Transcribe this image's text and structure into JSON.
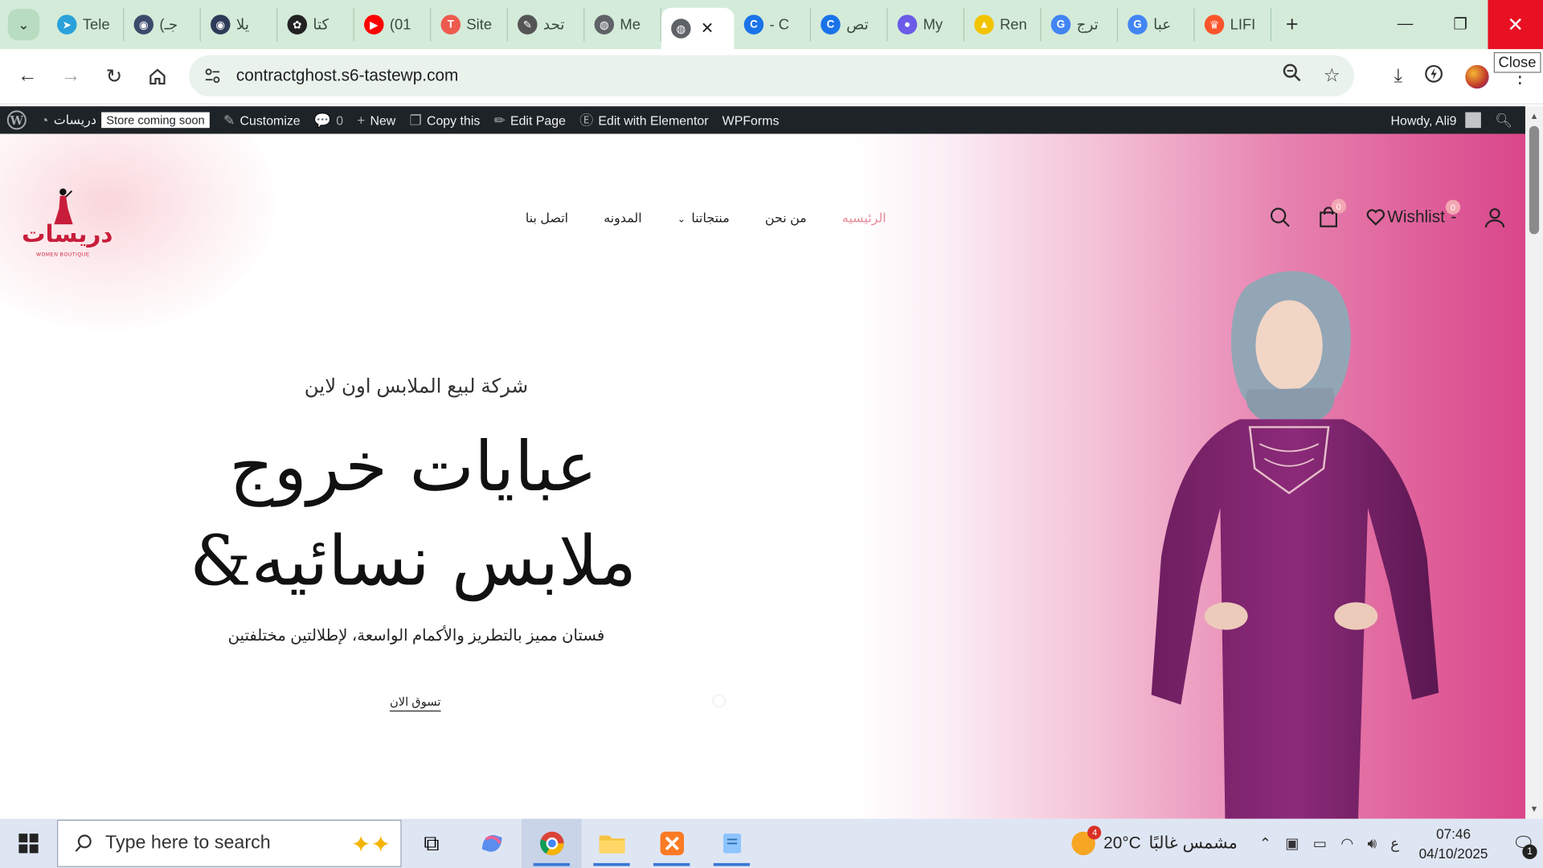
{
  "browser": {
    "tabs": [
      {
        "title": "Tele",
        "icon": "telegram-icon",
        "color": "#2aa1da",
        "glyph": "➤"
      },
      {
        "title": "(جـ",
        "icon": "globe-icon",
        "color": "#3b4a6b",
        "glyph": "◉"
      },
      {
        "title": "يلا",
        "icon": "globe-icon",
        "color": "#2d3b58",
        "glyph": "◉"
      },
      {
        "title": "كتا",
        "icon": "chatgpt-icon",
        "color": "#222222",
        "glyph": "✿"
      },
      {
        "title": "(01",
        "icon": "youtube-icon",
        "color": "#ff0000",
        "glyph": "▶"
      },
      {
        "title": "Site",
        "icon": "tistory-icon",
        "color": "#ef5a4f",
        "glyph": "T"
      },
      {
        "title": "تحد",
        "icon": "quill-icon",
        "color": "#555555",
        "glyph": "✎"
      },
      {
        "title": "Me",
        "icon": "globe-icon",
        "color": "#5f6368",
        "glyph": "◍"
      },
      {
        "title": "",
        "icon": "globe-icon",
        "color": "#5f6368",
        "glyph": "◍",
        "active": true
      },
      {
        "title": "- C",
        "icon": "copilot-icon",
        "color": "#1a73e8",
        "glyph": "C"
      },
      {
        "title": "تص",
        "icon": "copilot-icon",
        "color": "#1a73e8",
        "glyph": "C"
      },
      {
        "title": "My",
        "icon": "my-app-icon",
        "color": "#6b5be8",
        "glyph": "●"
      },
      {
        "title": "Ren",
        "icon": "rendering-icon",
        "color": "#f2c400",
        "glyph": "▲"
      },
      {
        "title": "ترج",
        "icon": "google-icon",
        "color": "#4285f4",
        "glyph": "G"
      },
      {
        "title": "عبا",
        "icon": "google-icon",
        "color": "#4285f4",
        "glyph": "G"
      },
      {
        "title": "LIFI",
        "icon": "brave-icon",
        "color": "#fb542b",
        "glyph": "♛"
      }
    ],
    "close_tooltip": "Close",
    "url": "contractghost.s6-tastewp.com"
  },
  "adminbar": {
    "site_name": "دريسات",
    "store_badge": "Store coming soon",
    "customize": "Customize",
    "comments": "0",
    "new": "New",
    "copy": "Copy this",
    "edit_page": "Edit Page",
    "elementor": "Edit with Elementor",
    "wpforms": "WPForms",
    "howdy": "Howdy, Ali9"
  },
  "site": {
    "logo_text": "دريسات",
    "logo_sub": "WOMEN BOUTIQUE",
    "menu": [
      {
        "label": "الرئيسيه",
        "active": true
      },
      {
        "label": "من نحن"
      },
      {
        "label": "منتجاتنا",
        "dropdown": true
      },
      {
        "label": "المدونه"
      },
      {
        "label": "اتصل بنا"
      }
    ],
    "cart_count": "0",
    "wishlist_label": "Wishlist",
    "wishlist_suffix": "-",
    "wishlist_count": "0",
    "hero": {
      "subtitle": "شركة لبيع الملابس اون لاين",
      "title_line1": "عبايات خروج",
      "title_line2": "&ملابس نسائيه",
      "description": "فستان مميز بالتطريز والأكمام الواسعة، لإطلالتين مختلفتين",
      "cta": "تسوق الان"
    }
  },
  "taskbar": {
    "search_placeholder": "Type here to search",
    "weather_temp": "20°C",
    "weather_text": "مشمس غالبًا",
    "weather_badge": "4",
    "lang": "ع",
    "time": "07:46",
    "date": "04/10/2025",
    "notif_count": "1"
  }
}
